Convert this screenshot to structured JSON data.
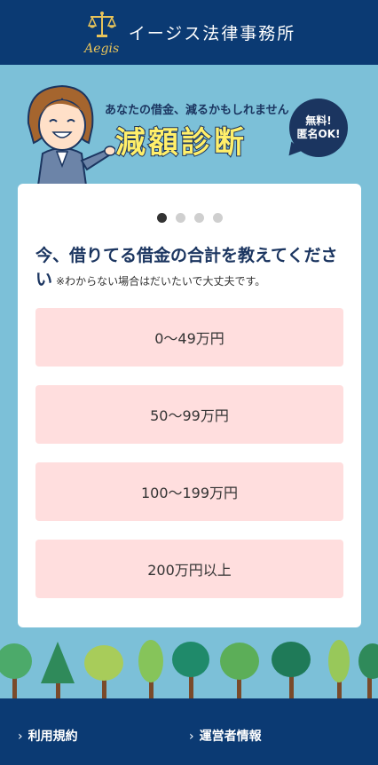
{
  "header": {
    "logo_text": "Aegis",
    "brand_name": "イージス法律事務所"
  },
  "hero": {
    "tagline": "あなたの借金、減るかもしれません",
    "title": "減額診断",
    "badge_line1": "無料!",
    "badge_line2": "匿名OK!"
  },
  "quiz": {
    "step": 1,
    "total_steps": 4,
    "question": "今、借りてる借金の合計を教えてください",
    "note": "※わからない場合はだいたいで大丈夫です。",
    "options": [
      "0〜49万円",
      "50〜99万円",
      "100〜199万円",
      "200万円以上"
    ]
  },
  "footer": {
    "links": [
      "利用規約",
      "運営者情報"
    ]
  },
  "colors": {
    "header_bg": "#0b3a73",
    "page_bg": "#7cc0d8",
    "option_bg": "#ffdede",
    "title_yellow": "#ffef6a"
  }
}
